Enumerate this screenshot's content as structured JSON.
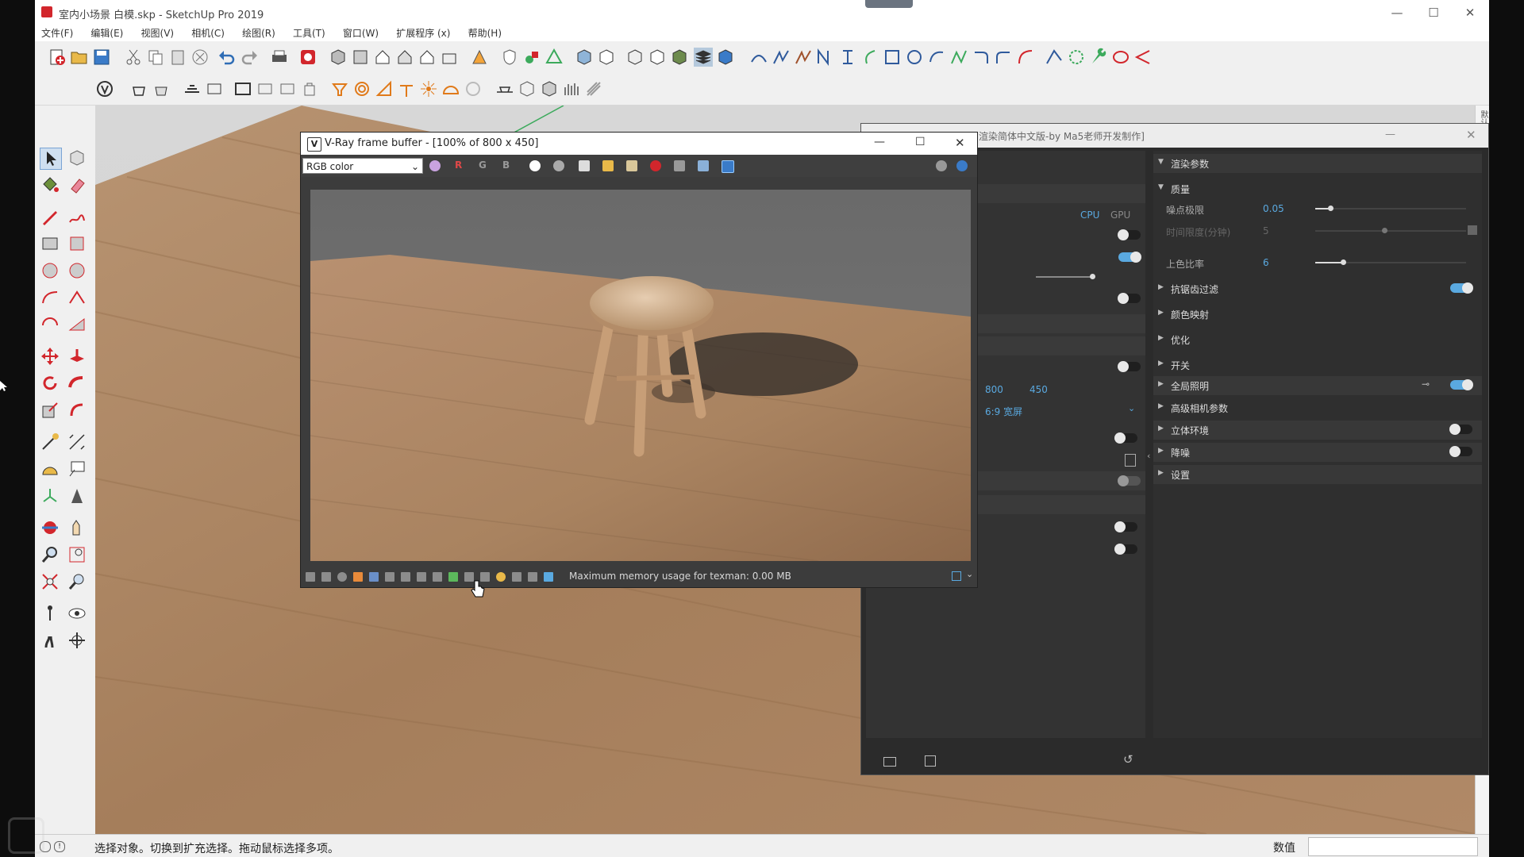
{
  "window": {
    "title": "室内小场景 白模.skp - SketchUp Pro 2019",
    "minimize": "—",
    "maximize": "☐",
    "close": "✕"
  },
  "menu": [
    "文件(F)",
    "编辑(E)",
    "视图(V)",
    "相机(C)",
    "绘图(R)",
    "工具(T)",
    "窗口(W)",
    "扩展程序 (x)",
    "帮助(H)"
  ],
  "right_strip": {
    "label": "默认面板"
  },
  "status": {
    "hint": "选择对象。切换到扩充选择。拖动鼠标选择多项。",
    "measure_label": "数值",
    "measure_value": ""
  },
  "vray_settings": {
    "title": "渲染简体中文版-by Ma5老师开发制作]",
    "engine_cpu": "CPU",
    "engine_gpu": "GPU",
    "resolution_w": "800",
    "resolution_h": "450",
    "aspect": "6:9 宽屏",
    "sections": [
      {
        "label": "渲染参数",
        "expanded": true,
        "toggle": null
      },
      {
        "label": "质量",
        "expanded": true,
        "toggle": null
      },
      {
        "label": "抗锯齿过滤",
        "expanded": false,
        "toggle": "on"
      },
      {
        "label": "颜色映射",
        "expanded": false,
        "toggle": null
      },
      {
        "label": "优化",
        "expanded": false,
        "toggle": null
      },
      {
        "label": "开关",
        "expanded": false,
        "toggle": null
      },
      {
        "label": "全局照明",
        "expanded": false,
        "toggle": "on"
      },
      {
        "label": "高级相机参数",
        "expanded": false,
        "toggle": null
      },
      {
        "label": "立体环境",
        "expanded": false,
        "toggle": "off"
      },
      {
        "label": "降噪",
        "expanded": false,
        "toggle": "off"
      },
      {
        "label": "设置",
        "expanded": false,
        "toggle": null
      }
    ],
    "params": [
      {
        "label": "噪点极限",
        "value": "0.05",
        "slider": 0.1
      },
      {
        "label": "时间限度(分钟)",
        "value": "5",
        "slider": 0.4
      },
      {
        "label": "上色比率",
        "value": "6",
        "slider": 0.18
      }
    ]
  },
  "frame_buffer": {
    "title": "V-Ray frame buffer - [100% of 800 x 450]",
    "channel": "RGB color",
    "channel_r": "R",
    "channel_g": "G",
    "channel_b": "B",
    "status_message": "Maximum memory usage for texman: 0.00 MB"
  },
  "colors": {
    "accent_blue": "#5aa9e0",
    "sketchup_red": "#d2262c",
    "vray_dark": "#2b2b2b"
  }
}
